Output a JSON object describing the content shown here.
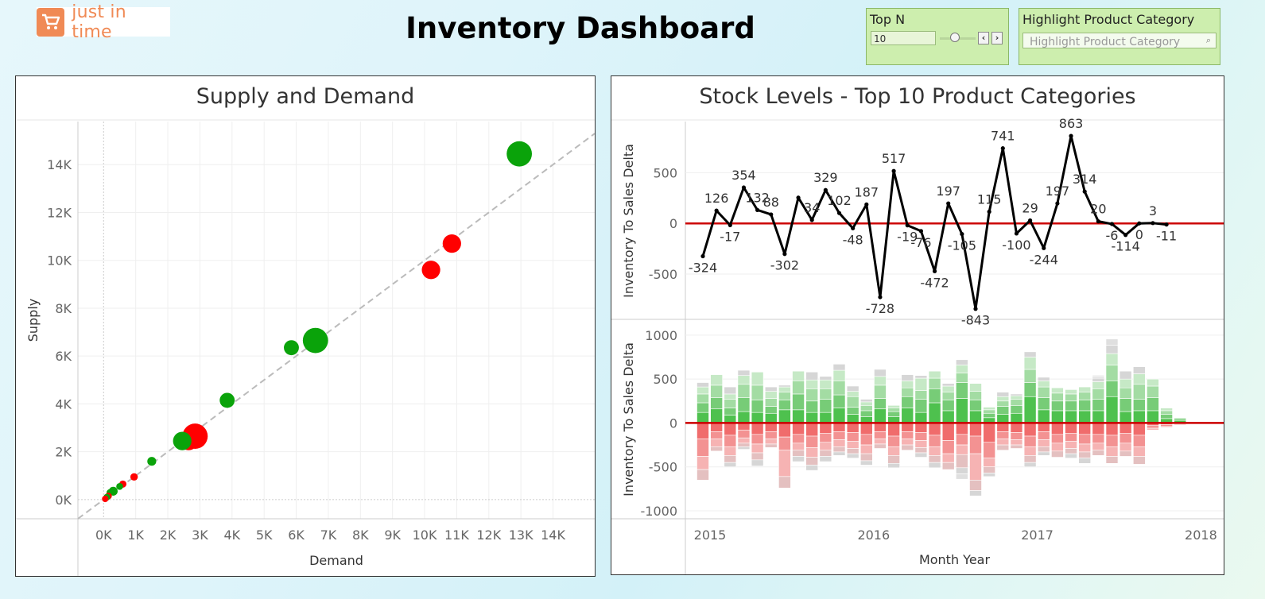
{
  "logo": {
    "text": "just in time",
    "icon": "cart-icon",
    "color": "#f08a55"
  },
  "dashboard_title": "Inventory Dashboard",
  "controls": {
    "topn": {
      "label": "Top N",
      "value": "10"
    },
    "highlight": {
      "label": "Highlight Product Category",
      "placeholder": "Highlight Product Category"
    }
  },
  "panels": {
    "supply_demand_title": "Supply and Demand",
    "stock_levels_title": "Stock Levels  - Top  10 Product Categories"
  },
  "colors": {
    "green": "#0aa30a",
    "red": "#ff0000",
    "zero_line": "#cc0000",
    "line": "#000000"
  },
  "chart_data": [
    {
      "type": "scatter",
      "title": "Supply and Demand",
      "xlabel": "Demand",
      "ylabel": "Supply",
      "xlim": [
        -800,
        15300
      ],
      "ylim": [
        -800,
        15800
      ],
      "xticks": [
        "0K",
        "1K",
        "2K",
        "3K",
        "4K",
        "5K",
        "6K",
        "7K",
        "8K",
        "9K",
        "10K",
        "11K",
        "12K",
        "13K",
        "14K"
      ],
      "yticks": [
        "0K",
        "2K",
        "4K",
        "6K",
        "8K",
        "10K",
        "12K",
        "14K"
      ],
      "reference_line": "y = x",
      "points": [
        {
          "x": 12950,
          "y": 14450,
          "size": 3,
          "color": "green"
        },
        {
          "x": 10850,
          "y": 10700,
          "size": 2,
          "color": "red"
        },
        {
          "x": 10200,
          "y": 9600,
          "size": 2,
          "color": "red"
        },
        {
          "x": 6600,
          "y": 6650,
          "size": 3,
          "color": "green"
        },
        {
          "x": 5850,
          "y": 6350,
          "size": 1.5,
          "color": "green"
        },
        {
          "x": 3850,
          "y": 4150,
          "size": 1.5,
          "color": "green"
        },
        {
          "x": 2850,
          "y": 2650,
          "size": 3,
          "color": "red"
        },
        {
          "x": 2650,
          "y": 2450,
          "size": 2,
          "color": "red"
        },
        {
          "x": 2450,
          "y": 2450,
          "size": 2,
          "color": "green"
        },
        {
          "x": 1500,
          "y": 1600,
          "size": 0.6,
          "color": "green"
        },
        {
          "x": 950,
          "y": 950,
          "size": 0.4,
          "color": "red"
        },
        {
          "x": 600,
          "y": 650,
          "size": 0.35,
          "color": "red"
        },
        {
          "x": 500,
          "y": 550,
          "size": 0.3,
          "color": "green"
        },
        {
          "x": 300,
          "y": 350,
          "size": 0.6,
          "color": "green"
        },
        {
          "x": 200,
          "y": 300,
          "size": 0.3,
          "color": "green"
        },
        {
          "x": 150,
          "y": 150,
          "size": 0.3,
          "color": "red"
        },
        {
          "x": 100,
          "y": 100,
          "size": 0.3,
          "color": "green"
        },
        {
          "x": 50,
          "y": 30,
          "size": 0.25,
          "color": "red"
        }
      ]
    },
    {
      "type": "line",
      "title": "Stock Levels  - Top  10 Product Categories",
      "ylabel": "Inventory To Sales Delta",
      "ylim": [
        -900,
        950
      ],
      "yticks": [
        500,
        0,
        -500
      ],
      "x": [
        "2015-01",
        "2015-02",
        "2015-03",
        "2015-04",
        "2015-05",
        "2015-06",
        "2015-07",
        "2015-08",
        "2015-09",
        "2015-10",
        "2015-11",
        "2015-12",
        "2016-01",
        "2016-02",
        "2016-03",
        "2016-04",
        "2016-05",
        "2016-06",
        "2016-07",
        "2016-08",
        "2016-09",
        "2016-10",
        "2016-11",
        "2016-12",
        "2017-01",
        "2017-02",
        "2017-03",
        "2017-04",
        "2017-05",
        "2017-06",
        "2017-07",
        "2017-08",
        "2017-09",
        "2017-10",
        "2017-11",
        "2017-12"
      ],
      "values": [
        -324,
        126,
        -17,
        354,
        132,
        88,
        -302,
        254,
        34,
        329,
        102,
        -48,
        187,
        -728,
        517,
        -19,
        -76,
        -472,
        197,
        -105,
        -843,
        115,
        741,
        -100,
        29,
        -244,
        197,
        863,
        314,
        20,
        -6,
        -114,
        0,
        3,
        -11,
        null
      ],
      "labels": [
        "-324",
        "126",
        "-17",
        "354",
        "132",
        "88",
        "-302",
        "",
        "34",
        "329",
        "102",
        "-48",
        "187",
        "-728",
        "517",
        "-19",
        "-76",
        "-472",
        "197",
        "-105",
        "-843",
        "115",
        "741",
        "-100",
        "29",
        "-244",
        "197",
        "863",
        "314",
        "20",
        "-6",
        "-114",
        "0",
        "3",
        "-11",
        ""
      ]
    },
    {
      "type": "bar",
      "subtype": "stacked diverging",
      "ylabel": "Inventory To Sales Delta",
      "xlabel": "Month Year",
      "ylim": [
        -1000,
        1080
      ],
      "yticks": [
        1000,
        500,
        0,
        -500,
        -1000
      ],
      "x_axis_labels": [
        "2015",
        "2016",
        "2017",
        "2018"
      ],
      "months": [
        "2015-01",
        "2015-02",
        "2015-03",
        "2015-04",
        "2015-05",
        "2015-06",
        "2015-07",
        "2015-08",
        "2015-09",
        "2015-10",
        "2015-11",
        "2015-12",
        "2016-01",
        "2016-02",
        "2016-03",
        "2016-04",
        "2016-05",
        "2016-06",
        "2016-07",
        "2016-08",
        "2016-09",
        "2016-10",
        "2016-11",
        "2016-12",
        "2017-01",
        "2017-02",
        "2017-03",
        "2017-04",
        "2017-05",
        "2017-06",
        "2017-07",
        "2017-08",
        "2017-09",
        "2017-10",
        "2017-11",
        "2017-12"
      ],
      "positive": [
        [
          120,
          110,
          100,
          80,
          50
        ],
        [
          160,
          130,
          140,
          120
        ],
        [
          90,
          80,
          100,
          60,
          80
        ],
        [
          130,
          160,
          150,
          100,
          60
        ],
        [
          120,
          140,
          170,
          150
        ],
        [
          110,
          80,
          90,
          80,
          50
        ],
        [
          150,
          110,
          90,
          60,
          20
        ],
        [
          150,
          180,
          150,
          110
        ],
        [
          120,
          130,
          140,
          100,
          90
        ],
        [
          120,
          150,
          120,
          100,
          40
        ],
        [
          170,
          150,
          160,
          120,
          70
        ],
        [
          100,
          80,
          120,
          60,
          60
        ],
        [
          70,
          70,
          60,
          40,
          30
        ],
        [
          160,
          120,
          150,
          100,
          80
        ],
        [
          70,
          60,
          40,
          30
        ],
        [
          170,
          130,
          100,
          80,
          70
        ],
        [
          120,
          150,
          100,
          140,
          30
        ],
        [
          230,
          160,
          120,
          80
        ],
        [
          140,
          120,
          90,
          70,
          30
        ],
        [
          280,
          180,
          110,
          90,
          60
        ],
        [
          140,
          120,
          100,
          90
        ],
        [
          60,
          50,
          40,
          30
        ],
        [
          100,
          90,
          60,
          50,
          50
        ],
        [
          110,
          90,
          70,
          40,
          20
        ],
        [
          300,
          160,
          150,
          140,
          60
        ],
        [
          150,
          140,
          120,
          70,
          40
        ],
        [
          140,
          110,
          90,
          60
        ],
        [
          140,
          110,
          80,
          50
        ],
        [
          140,
          120,
          90,
          60
        ],
        [
          140,
          130,
          120,
          80,
          40,
          20,
          15
        ],
        [
          300,
          180,
          180,
          130,
          95,
          70
        ],
        [
          130,
          150,
          120,
          100,
          90
        ],
        [
          140,
          130,
          170,
          120,
          80
        ],
        [
          140,
          150,
          130,
          80
        ],
        [
          50,
          50,
          40,
          30
        ],
        [
          30,
          20,
          10
        ]
      ],
      "negative": [
        [
          180,
          200,
          150,
          120
        ],
        [
          100,
          80,
          90,
          50
        ],
        [
          140,
          130,
          100,
          80,
          50
        ],
        [
          80,
          90,
          60,
          40,
          30
        ],
        [
          130,
          110,
          100,
          80,
          70
        ],
        [
          100,
          80,
          60,
          40
        ],
        [
          160,
          150,
          300,
          130
        ],
        [
          130,
          100,
          80,
          70,
          60
        ],
        [
          150,
          130,
          110,
          90,
          60
        ],
        [
          120,
          100,
          90,
          70,
          60
        ],
        [
          100,
          90,
          80,
          60,
          40
        ],
        [
          110,
          100,
          80,
          60,
          50
        ],
        [
          130,
          120,
          100,
          80,
          50
        ],
        [
          100,
          80,
          60,
          50
        ],
        [
          150,
          120,
          100,
          90,
          50
        ],
        [
          100,
          80,
          70,
          60
        ],
        [
          110,
          90,
          80,
          60,
          50
        ],
        [
          140,
          130,
          100,
          80,
          60
        ],
        [
          200,
          150,
          100,
          80
        ],
        [
          130,
          120,
          110,
          150,
          70,
          60
        ],
        [
          150,
          200,
          300,
          120,
          60
        ],
        [
          220,
          180,
          100,
          70,
          40
        ],
        [
          100,
          80,
          70,
          60
        ],
        [
          110,
          80,
          60,
          40
        ],
        [
          150,
          120,
          100,
          80,
          50
        ],
        [
          100,
          90,
          80,
          60,
          40
        ],
        [
          130,
          100,
          90,
          70
        ],
        [
          120,
          90,
          80,
          60,
          50
        ],
        [
          130,
          110,
          90,
          70,
          60
        ],
        [
          130,
          100,
          80,
          60
        ],
        [
          140,
          130,
          110,
          80
        ],
        [
          120,
          110,
          90,
          60
        ],
        [
          140,
          130,
          110,
          90
        ],
        [
          30,
          30,
          20
        ],
        [
          20,
          20,
          10
        ],
        [
          10,
          10
        ]
      ]
    }
  ]
}
